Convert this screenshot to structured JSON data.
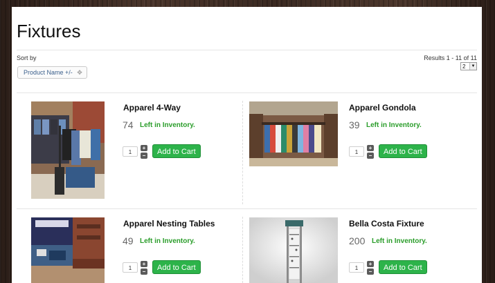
{
  "page": {
    "title": "Fixtures"
  },
  "sort": {
    "label": "Sort by",
    "button_label": "Product Name +/-",
    "icon": "sort-arrows-icon"
  },
  "results": {
    "text": "Results 1 - 11 of 11",
    "page_selected": "2"
  },
  "inventory_label": "Left in Inventory.",
  "add_to_cart_label": "Add to Cart",
  "products": [
    {
      "name": "Apparel 4-Way",
      "count": "74",
      "qty": "1"
    },
    {
      "name": "Apparel Gondola",
      "count": "39",
      "qty": "1"
    },
    {
      "name": "Apparel Nesting Tables",
      "count": "49",
      "qty": "1"
    },
    {
      "name": "Bella Costa Fixture",
      "count": "200",
      "qty": "1"
    }
  ],
  "colors": {
    "accent_green": "#2db34a",
    "stock_green": "#2a9d2a",
    "link_blue": "#3a5f8c"
  }
}
